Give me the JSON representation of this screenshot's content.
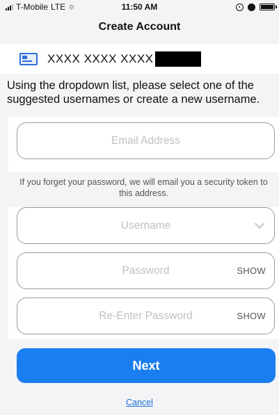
{
  "status_bar": {
    "carrier": "T-Mobile",
    "network": "LTE",
    "time": "11:50 AM"
  },
  "nav": {
    "title": "Create Account"
  },
  "account": {
    "icon": "card-icon",
    "number": "XXXX XXXX XXXX"
  },
  "instructions": "Using the dropdown list, please select one of the suggested usernames or create a new username.",
  "form": {
    "email_placeholder": "Email Address",
    "help_text": "If you forget your password, we will email you a security token to this address.",
    "username_placeholder": "Username",
    "password_placeholder": "Password",
    "reenter_placeholder": "Re-Enter Password",
    "show_label": "SHOW"
  },
  "actions": {
    "next_label": "Next",
    "cancel_label": "Cancel"
  },
  "colors": {
    "accent": "#1a7ef0",
    "link": "#1a6fd6",
    "background": "#f4f4f6"
  }
}
